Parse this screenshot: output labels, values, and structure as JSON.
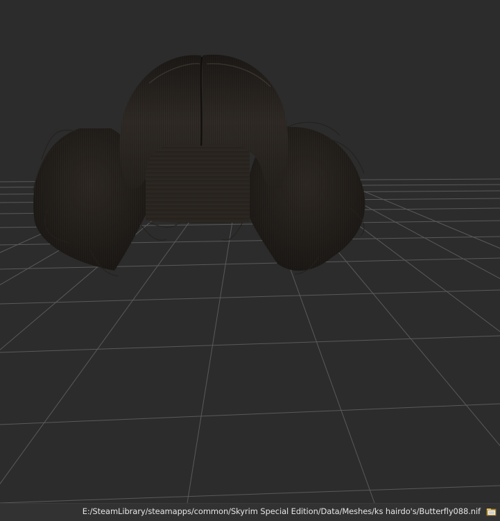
{
  "viewport": {
    "background_color": "#2c2c2c",
    "grid_color": "#6a6a6a",
    "hair_color": "#2a2520"
  },
  "statusbar": {
    "file_path": "E:/SteamLibrary/steamapps/common/Skyrim Special Edition/Data/Meshes/ks hairdo's/Butterfly088.nif",
    "icon": "folder-open-icon"
  }
}
